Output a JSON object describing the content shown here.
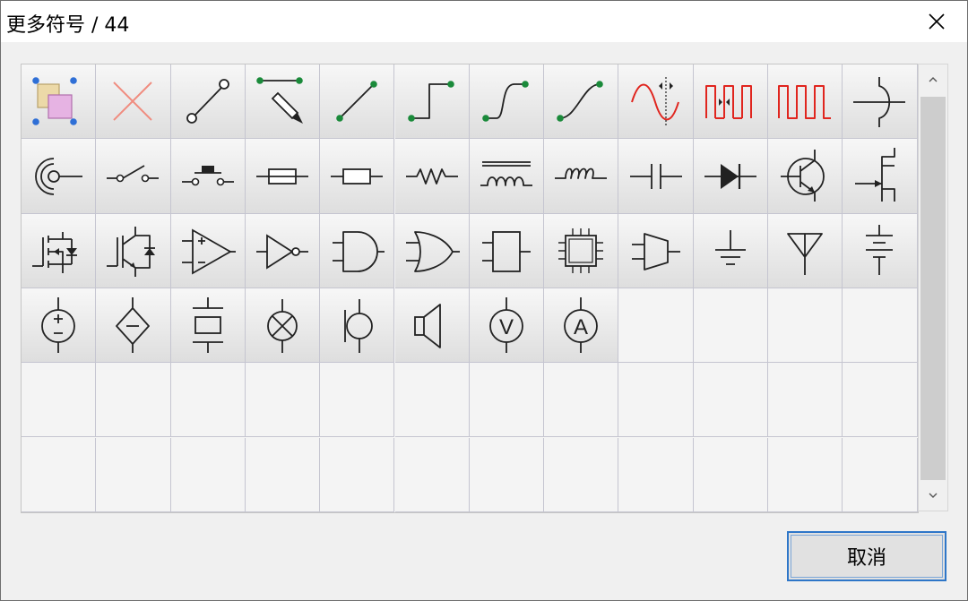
{
  "window": {
    "title": "更多符号 / 44"
  },
  "cancel_label": "取消",
  "colors": {
    "accent": "#2e76c8",
    "green_node": "#1a8a3a",
    "red_signal": "#e0251e",
    "blue_handle": "#2f6fd6"
  },
  "symbols": [
    {
      "name": "group-select-icon"
    },
    {
      "name": "delete-cross-icon"
    },
    {
      "name": "line-open-nodes-icon"
    },
    {
      "name": "pencil-draw-icon"
    },
    {
      "name": "straight-line-icon"
    },
    {
      "name": "step-line-icon"
    },
    {
      "name": "s-curve-line-icon"
    },
    {
      "name": "smooth-curve-icon"
    },
    {
      "name": "sine-wave-icon"
    },
    {
      "name": "square-pulse-adjust-icon"
    },
    {
      "name": "square-wave-icon"
    },
    {
      "name": "wire-crossing-icon"
    },
    {
      "name": "coax-cable-icon"
    },
    {
      "name": "switch-icon"
    },
    {
      "name": "push-button-icon"
    },
    {
      "name": "fuse-icon"
    },
    {
      "name": "resistor-icon"
    },
    {
      "name": "resistor-zigzag-icon"
    },
    {
      "name": "inductor-core-icon"
    },
    {
      "name": "inductor-icon"
    },
    {
      "name": "capacitor-icon"
    },
    {
      "name": "diode-icon"
    },
    {
      "name": "transistor-icon"
    },
    {
      "name": "jfet-icon"
    },
    {
      "name": "mosfet-icon"
    },
    {
      "name": "igbt-icon"
    },
    {
      "name": "op-amp-icon"
    },
    {
      "name": "not-gate-icon"
    },
    {
      "name": "and-gate-icon"
    },
    {
      "name": "or-gate-icon"
    },
    {
      "name": "block-icon"
    },
    {
      "name": "ic-chip-icon"
    },
    {
      "name": "mux-icon"
    },
    {
      "name": "ground-icon"
    },
    {
      "name": "antenna-icon"
    },
    {
      "name": "battery-icon"
    },
    {
      "name": "voltage-source-icon"
    },
    {
      "name": "dependent-source-icon"
    },
    {
      "name": "crystal-icon"
    },
    {
      "name": "lamp-icon"
    },
    {
      "name": "microphone-icon"
    },
    {
      "name": "speaker-icon"
    },
    {
      "name": "voltmeter-icon",
      "text": "V"
    },
    {
      "name": "ammeter-icon",
      "text": "A"
    }
  ],
  "grid": {
    "columns": 12,
    "rows": 6
  }
}
